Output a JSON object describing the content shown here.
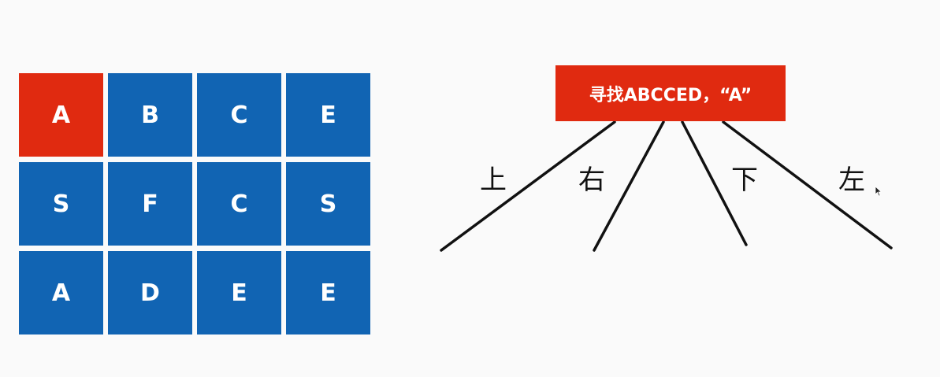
{
  "grid": {
    "rows": [
      [
        "A",
        "B",
        "C",
        "E"
      ],
      [
        "S",
        "F",
        "C",
        "S"
      ],
      [
        "A",
        "D",
        "E",
        "E"
      ]
    ],
    "highlight": {
      "row": 0,
      "col": 0
    },
    "colors": {
      "cell": "#1164b3",
      "highlight": "#e02a10",
      "text": "#ffffff"
    }
  },
  "tree": {
    "root_label": "寻找ABCCED，“A”",
    "root_color": "#e02a10",
    "branches": [
      {
        "label": "上"
      },
      {
        "label": "右"
      },
      {
        "label": "下"
      },
      {
        "label": "左"
      }
    ]
  }
}
